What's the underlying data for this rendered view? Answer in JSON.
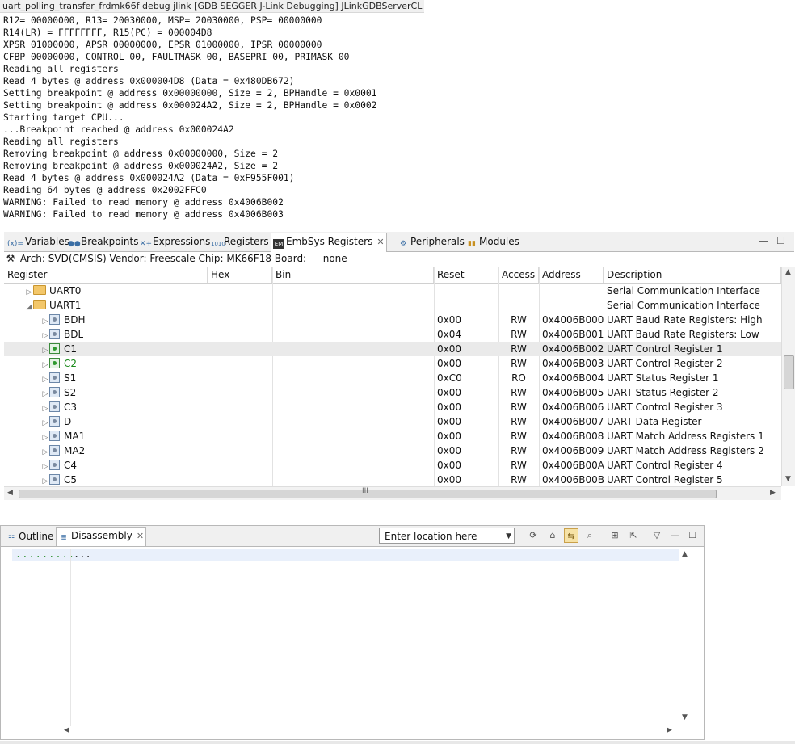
{
  "console": {
    "title": "uart_polling_transfer_frdmk66f debug jlink [GDB SEGGER J-Link Debugging] JLinkGDBServerCL",
    "lines": [
      "R12= 00000000, R13= 20030000, MSP= 20030000, PSP= 00000000",
      "R14(LR) = FFFFFFFF, R15(PC) = 000004D8",
      "XPSR 01000000, APSR 00000000, EPSR 01000000, IPSR 00000000",
      "CFBP 00000000, CONTROL 00, FAULTMASK 00, BASEPRI 00, PRIMASK 00",
      "Reading all registers",
      "Read 4 bytes @ address 0x000004D8 (Data = 0x480DB672)",
      "Setting breakpoint @ address 0x00000000, Size = 2, BPHandle = 0x0001",
      "Setting breakpoint @ address 0x000024A2, Size = 2, BPHandle = 0x0002",
      "Starting target CPU...",
      "...Breakpoint reached @ address 0x000024A2",
      "Reading all registers",
      "Removing breakpoint @ address 0x00000000, Size = 2",
      "Removing breakpoint @ address 0x000024A2, Size = 2",
      "Read 4 bytes @ address 0x000024A2 (Data = 0xF955F001)",
      "Reading 64 bytes @ address 0x2002FFC0",
      "WARNING: Failed to read memory @ address 0x4006B002",
      "WARNING: Failed to read memory @ address 0x4006B003"
    ]
  },
  "views": {
    "tabs": [
      {
        "label": "Variables",
        "icon": "variables-icon",
        "glyph": "(x)="
      },
      {
        "label": "Breakpoints",
        "icon": "breakpoints-icon",
        "glyph": "●●"
      },
      {
        "label": "Expressions",
        "icon": "expressions-icon",
        "glyph": "✕+"
      },
      {
        "label": "Registers",
        "icon": "registers-icon",
        "glyph": "1010"
      },
      {
        "label": "EmbSys Registers",
        "icon": "embsys-icon",
        "glyph": "EM"
      },
      {
        "label": "Peripherals",
        "icon": "peripherals-icon",
        "glyph": "⚙"
      },
      {
        "label": "Modules",
        "icon": "modules-icon",
        "glyph": "▮▮"
      }
    ],
    "active_tab": "EmbSys Registers",
    "close_glyph": "✕",
    "minimize_glyph": "—",
    "maximize_glyph": "☐"
  },
  "embsys": {
    "arch_line": "Arch: SVD(CMSIS)  Vendor: Freescale  Chip: MK66F18  Board: ---  none ---",
    "columns": [
      "Register",
      "Hex",
      "Bin",
      "Reset",
      "Access",
      "Address",
      "Description"
    ],
    "groups": [
      {
        "name": "UART0",
        "expanded": false,
        "description": "Serial Communication Interface"
      },
      {
        "name": "UART1",
        "expanded": true,
        "description": "Serial Communication Interface"
      }
    ],
    "registers": [
      {
        "name": "BDH",
        "reset": "0x00",
        "access": "RW",
        "address": "0x4006B000",
        "description": "UART Baud Rate Registers: High",
        "changed": false,
        "selected": false
      },
      {
        "name": "BDL",
        "reset": "0x04",
        "access": "RW",
        "address": "0x4006B001",
        "description": "UART Baud Rate Registers: Low",
        "changed": false,
        "selected": false
      },
      {
        "name": "C1",
        "reset": "0x00",
        "access": "RW",
        "address": "0x4006B002",
        "description": "UART Control Register 1",
        "changed": true,
        "selected": true
      },
      {
        "name": "C2",
        "reset": "0x00",
        "access": "RW",
        "address": "0x4006B003",
        "description": "UART Control Register 2",
        "changed": true,
        "selected": false
      },
      {
        "name": "S1",
        "reset": "0xC0",
        "access": "RO",
        "address": "0x4006B004",
        "description": "UART Status Register 1",
        "changed": false,
        "selected": false
      },
      {
        "name": "S2",
        "reset": "0x00",
        "access": "RW",
        "address": "0x4006B005",
        "description": "UART Status Register 2",
        "changed": false,
        "selected": false
      },
      {
        "name": "C3",
        "reset": "0x00",
        "access": "RW",
        "address": "0x4006B006",
        "description": "UART Control Register 3",
        "changed": false,
        "selected": false
      },
      {
        "name": "D",
        "reset": "0x00",
        "access": "RW",
        "address": "0x4006B007",
        "description": "UART Data Register",
        "changed": false,
        "selected": false
      },
      {
        "name": "MA1",
        "reset": "0x00",
        "access": "RW",
        "address": "0x4006B008",
        "description": "UART Match Address Registers 1",
        "changed": false,
        "selected": false
      },
      {
        "name": "MA2",
        "reset": "0x00",
        "access": "RW",
        "address": "0x4006B009",
        "description": "UART Match Address Registers 2",
        "changed": false,
        "selected": false
      },
      {
        "name": "C4",
        "reset": "0x00",
        "access": "RW",
        "address": "0x4006B00A",
        "description": "UART Control Register 4",
        "changed": false,
        "selected": false
      },
      {
        "name": "C5",
        "reset": "0x00",
        "access": "RW",
        "address": "0x4006B00B",
        "description": "UART Control Register 5",
        "changed": false,
        "selected": false
      }
    ],
    "scroll_grip": "III"
  },
  "disassembly": {
    "tabs": [
      {
        "label": "Outline",
        "icon": "outline-icon"
      },
      {
        "label": "Disassembly",
        "icon": "disassembly-icon"
      }
    ],
    "location_placeholder": "Enter location here",
    "address_dots": ".........",
    "code_dots": "..."
  },
  "colors": {
    "changed_register": "#1a8a1a",
    "selected_row": "#eaeaea",
    "disasm_current_line": "#e9f0fb"
  }
}
